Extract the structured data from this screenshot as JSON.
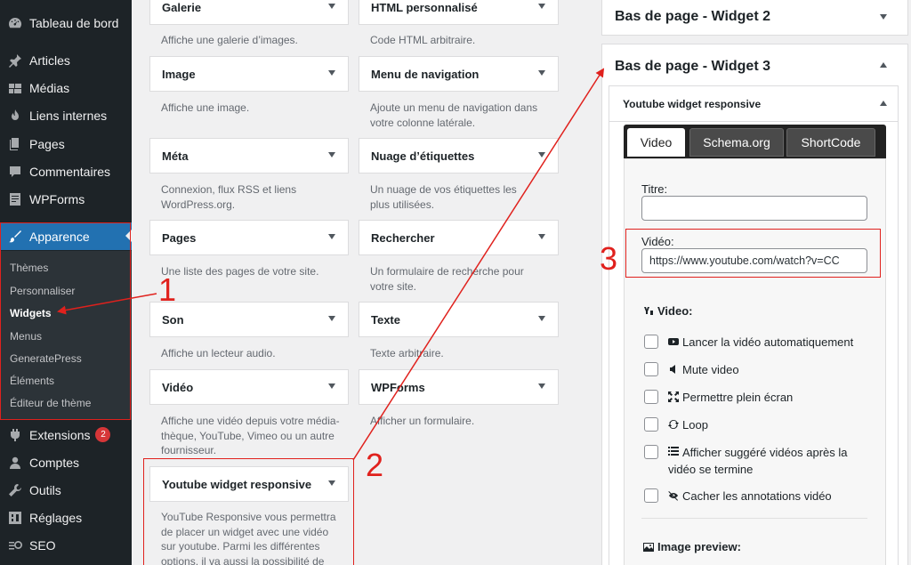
{
  "sidebar": {
    "items": [
      {
        "label": "Tableau de bord",
        "icon": "dashboard-icon"
      },
      {
        "label": "Articles",
        "icon": "pin-icon"
      },
      {
        "label": "Médias",
        "icon": "media-icon"
      },
      {
        "label": "Liens internes",
        "icon": "flame-icon"
      },
      {
        "label": "Pages",
        "icon": "page-icon"
      },
      {
        "label": "Commentaires",
        "icon": "comment-icon"
      },
      {
        "label": "WPForms",
        "icon": "form-icon"
      },
      {
        "label": "Apparence",
        "icon": "brush-icon"
      },
      {
        "label": "Extensions",
        "icon": "plugin-icon",
        "badge": "2"
      },
      {
        "label": "Comptes",
        "icon": "user-icon"
      },
      {
        "label": "Outils",
        "icon": "wrench-icon"
      },
      {
        "label": "Réglages",
        "icon": "settings-icon"
      },
      {
        "label": "SEO",
        "icon": "seo-icon"
      }
    ],
    "submenu": [
      "Thèmes",
      "Personnaliser",
      "Widgets",
      "Menus",
      "GeneratePress",
      "Éléments",
      "Éditeur de thème"
    ]
  },
  "available_widgets": [
    {
      "title": "Galerie",
      "desc": "Affiche une galerie d’images."
    },
    {
      "title": "HTML personnalisé",
      "desc": "Code HTML arbitraire."
    },
    {
      "title": "Image",
      "desc": "Affiche une image."
    },
    {
      "title": "Menu de navigation",
      "desc": "Ajoute un menu de navigation dans votre colonne latérale."
    },
    {
      "title": "Méta",
      "desc": "Connexion, flux RSS et liens WordPress.org."
    },
    {
      "title": "Nuage d’étiquettes",
      "desc": "Un nuage de vos étiquettes les plus utilisées."
    },
    {
      "title": "Pages",
      "desc": "Une liste des pages de votre site."
    },
    {
      "title": "Rechercher",
      "desc": "Un formulaire de recherche pour votre site."
    },
    {
      "title": "Son",
      "desc": "Affiche un lecteur audio."
    },
    {
      "title": "Texte",
      "desc": "Texte arbitraire."
    },
    {
      "title": "Vidéo",
      "desc": "Affiche une vidéo depuis votre média-thèque, YouTube, Vimeo ou un autre fournisseur."
    },
    {
      "title": "WPForms",
      "desc": "Afficher un formulaire."
    },
    {
      "title": "Youtube widget responsive",
      "desc": "YouTube Responsive vous permettra de placer un widget avec une vidéo sur youtube. Parmi les différentes options, il va aussi la possibilité de démarrer auto-"
    }
  ],
  "areas": {
    "footer2": "Bas de page - Widget 2",
    "footer3": "Bas de page - Widget 3",
    "inner_widget_title": "Youtube widget responsive"
  },
  "tabs": [
    "Video",
    "Schema.org",
    "ShortCode"
  ],
  "form": {
    "title_label": "Titre:",
    "title_value": "",
    "video_label": "Vidéo:",
    "video_value": "https://www.youtube.com/watch?v=CC",
    "video_section": "Video:",
    "options": [
      {
        "label": "Lancer la vidéo automatiquement",
        "icon": "play-icon"
      },
      {
        "label": "Mute video",
        "icon": "volume-icon"
      },
      {
        "label": "Permettre plein écran",
        "icon": "fullscreen-icon"
      },
      {
        "label": "Loop",
        "icon": "loop-icon"
      },
      {
        "label": "Afficher suggéré vidéos après la vidéo se termine",
        "icon": "list-icon"
      },
      {
        "label": "Cacher les annotations vidéo",
        "icon": "eye-slash-icon"
      }
    ],
    "image_preview_label": "Image preview:"
  },
  "annotations": [
    "1",
    "2",
    "3"
  ]
}
